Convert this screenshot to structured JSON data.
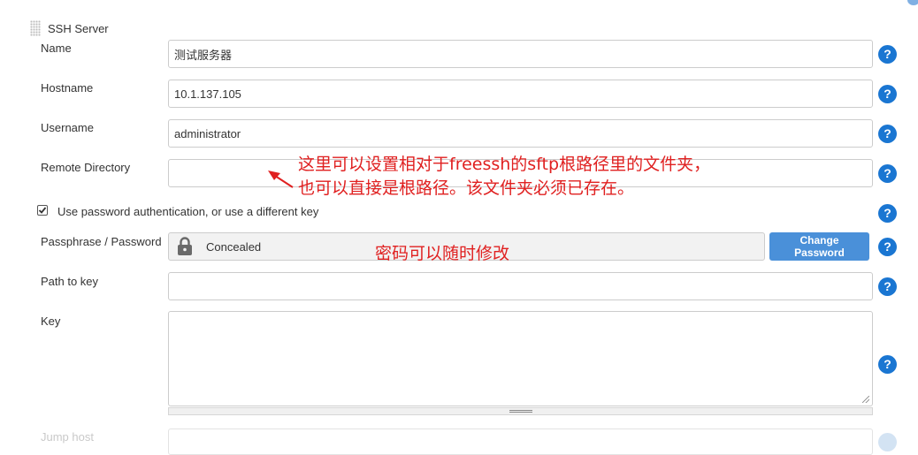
{
  "section": {
    "title": "SSH Server"
  },
  "fields": {
    "name": {
      "label": "Name",
      "value": "测试服务器"
    },
    "hostname": {
      "label": "Hostname",
      "value": "10.1.137.105"
    },
    "username": {
      "label": "Username",
      "value": "administrator"
    },
    "remote_directory": {
      "label": "Remote Directory",
      "value": ""
    },
    "use_password": {
      "label": "Use password authentication, or use a different key",
      "checked": true
    },
    "passphrase": {
      "label": "Passphrase / Password",
      "concealed_text": "Concealed",
      "change_button": "Change Password"
    },
    "path_to_key": {
      "label": "Path to key",
      "value": ""
    },
    "key": {
      "label": "Key",
      "value": ""
    },
    "jump_host": {
      "label": "Jump host"
    }
  },
  "help_icon": "?",
  "annotations": {
    "remote_dir_note_line1": "这里可以设置相对于freessh的sftp根路径里的文件夹，",
    "remote_dir_note_line2": "也可以直接是根路径。该文件夹必须已存在。",
    "password_note": "密码可以随时修改"
  },
  "colors": {
    "accent": "#1a76d2",
    "button": "#4a90d9",
    "annotation": "#e02020"
  }
}
